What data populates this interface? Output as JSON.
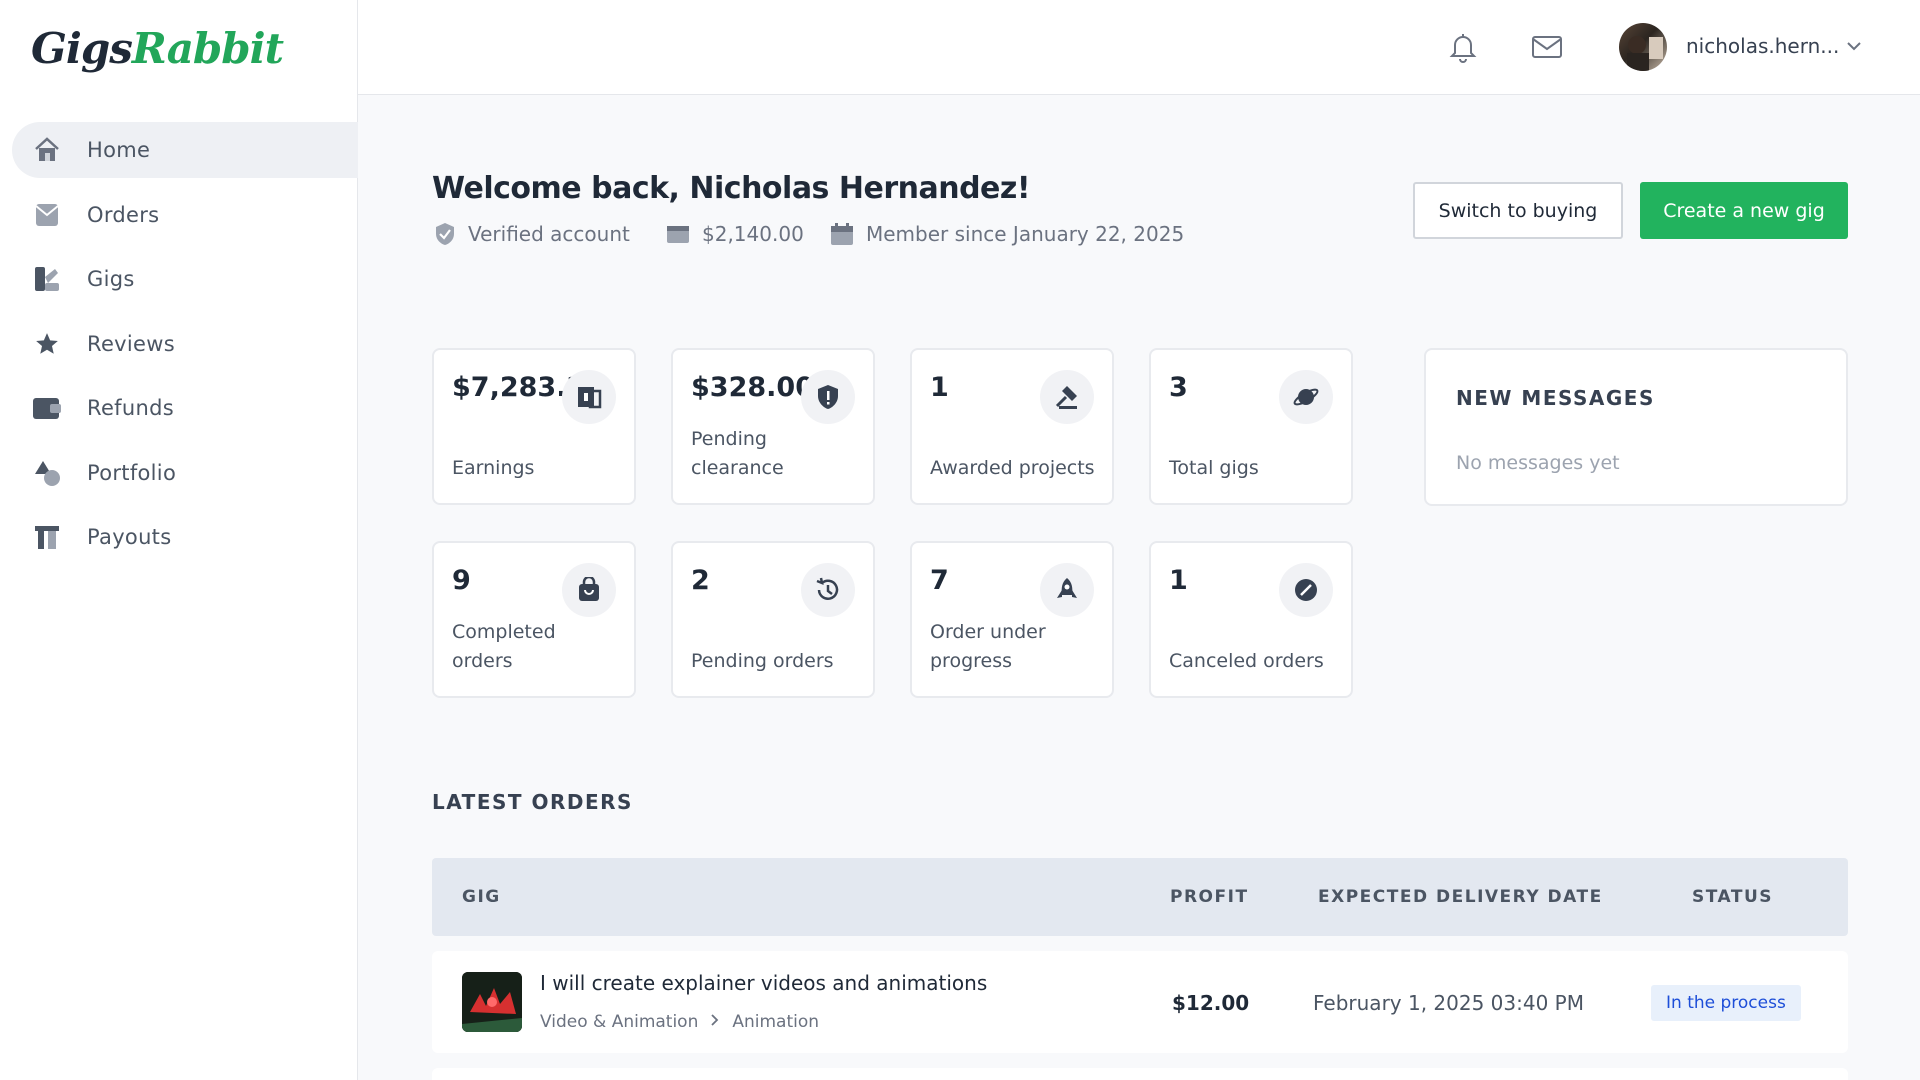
{
  "brand": {
    "part1": "Gigs",
    "part2": "Rabbit"
  },
  "sidebar": {
    "items": [
      {
        "label": "Home",
        "icon": "home-icon",
        "active": true
      },
      {
        "label": "Orders",
        "icon": "orders-icon"
      },
      {
        "label": "Gigs",
        "icon": "gigs-icon"
      },
      {
        "label": "Reviews",
        "icon": "star-icon"
      },
      {
        "label": "Refunds",
        "icon": "wallet-icon"
      },
      {
        "label": "Portfolio",
        "icon": "shapes-icon"
      },
      {
        "label": "Payouts",
        "icon": "payouts-icon"
      }
    ]
  },
  "topbar": {
    "username": "nicholas.hern...",
    "icons": [
      "bell-icon",
      "mail-icon",
      "chevron-down-icon"
    ]
  },
  "header": {
    "welcome": "Welcome back, Nicholas Hernandez!",
    "verified": "Verified account",
    "balance": "$2,140.00",
    "member_since": "Member since January 22, 2025",
    "switch_label": "Switch to buying",
    "create_label": "Create a new gig"
  },
  "stats": [
    {
      "value": "$7,283.21",
      "label": "Earnings",
      "icon": "earnings-icon"
    },
    {
      "value": "$328.00",
      "label": "Pending clearance",
      "icon": "shield-alert-icon"
    },
    {
      "value": "1",
      "label": "Awarded projects",
      "icon": "gavel-icon"
    },
    {
      "value": "3",
      "label": "Total gigs",
      "icon": "planet-icon"
    },
    {
      "value": "9",
      "label": "Completed orders",
      "icon": "bag-icon"
    },
    {
      "value": "2",
      "label": "Pending orders",
      "icon": "history-icon"
    },
    {
      "value": "7",
      "label": "Order under progress",
      "icon": "rocket-icon"
    },
    {
      "value": "1",
      "label": "Canceled orders",
      "icon": "cancel-icon"
    }
  ],
  "messages": {
    "title": "NEW MESSAGES",
    "empty": "No messages yet"
  },
  "orders": {
    "title": "LATEST ORDERS",
    "columns": [
      "GIG",
      "PROFIT",
      "EXPECTED DELIVERY DATE",
      "STATUS"
    ],
    "rows": [
      {
        "title": "I will create explainer videos and animations",
        "category": "Video & Animation",
        "subcategory": "Animation",
        "profit": "$12.00",
        "delivery": "February 1, 2025 03:40 PM",
        "status": "In the process"
      }
    ]
  },
  "colors": {
    "accent": "#22b35e",
    "status_text": "#1d4ed8",
    "status_bg": "#e8f0fb"
  }
}
